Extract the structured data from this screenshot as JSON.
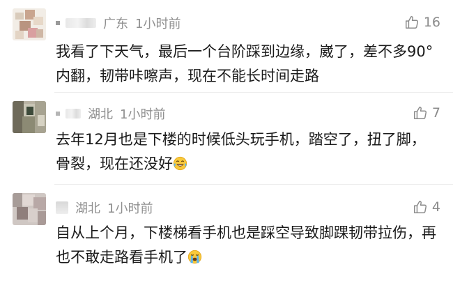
{
  "comments": [
    {
      "location": "广东",
      "time": "1小时前",
      "likes": "16",
      "text": "我看了下天气，最后一个台阶踩到边缘，崴了，差不多90°内翻，韧带咔嚓声，现在不能长时间走路",
      "avatar_icon": "blurred-avatar"
    },
    {
      "location": "湖北",
      "time": "1小时前",
      "likes": "7",
      "text": "去年12月也是下楼的时候低头玩手机，踏空了，扭了脚，骨裂，现在还没好",
      "emoji": "laughing-tears-emoji",
      "avatar_icon": "blurred-avatar"
    },
    {
      "location": "湖北",
      "time": "1小时前",
      "likes": "4",
      "text": "自从上个月，下楼梯看手机也是踩空导致脚踝韧带拉伤，再也不敢走路看手机了",
      "emoji": "crying-emoji",
      "avatar_icon": "blurred-avatar"
    }
  ],
  "colors": {
    "meta": "#8f8f8f",
    "text": "#1a1a1a",
    "divider": "#ececec"
  }
}
